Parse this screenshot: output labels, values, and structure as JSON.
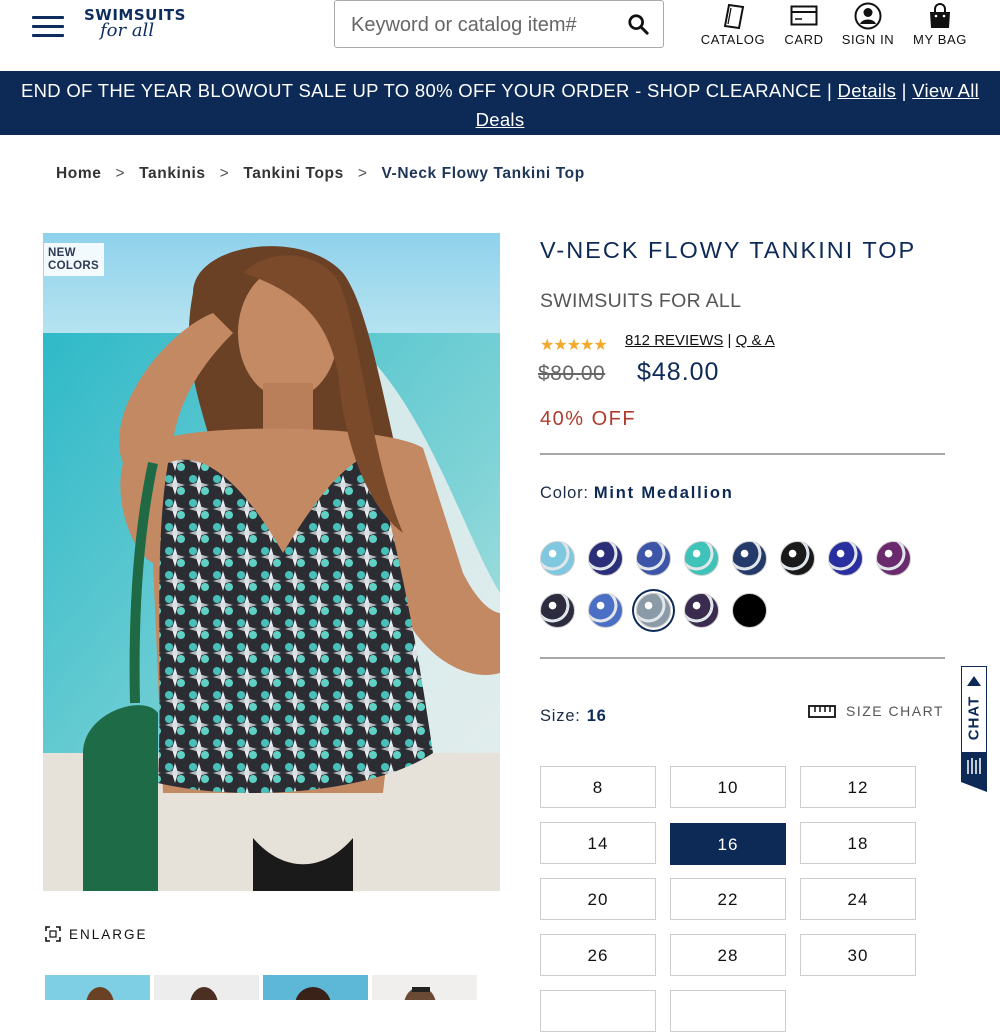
{
  "header": {
    "logo_top": "SWIMSUITS",
    "logo_bottom": "for all",
    "search_placeholder": "Keyword or catalog item#",
    "nav": [
      {
        "label": "CATALOG",
        "icon": "catalog-icon"
      },
      {
        "label": "CARD",
        "icon": "card-icon"
      },
      {
        "label": "SIGN IN",
        "icon": "user-icon"
      },
      {
        "label": "MY BAG",
        "icon": "bag-icon"
      }
    ]
  },
  "banner": {
    "text": "END OF THE YEAR BLOWOUT SALE UP TO 80% OFF YOUR ORDER - SHOP CLEARANCE",
    "sep": "|",
    "details": "Details",
    "view_all": "View All Deals"
  },
  "breadcrumb": [
    "Home",
    "Tankinis",
    "Tankini Tops",
    "V-Neck Flowy Tankini Top"
  ],
  "breadcrumb_sep": ">",
  "gallery": {
    "badge_line1": "NEW",
    "badge_line2": "COLORS",
    "enlarge": "ENLARGE"
  },
  "product": {
    "title": "V-NECK FLOWY TANKINI TOP",
    "brand": "SWIMSUITS FOR ALL",
    "stars": "★★★★★",
    "rating": 4.5,
    "reviews": "812 REVIEWS",
    "qa": "Q & A",
    "review_sep": "|",
    "old_price": "$80.00",
    "price": "$48.00",
    "discount": "40% OFF",
    "color_label": "Color:",
    "color_value": "Mint Medallion",
    "size_label": "Size:",
    "size_value": "16",
    "size_chart": "SIZE CHART",
    "sizes": [
      "8",
      "10",
      "12",
      "14",
      "16",
      "18",
      "20",
      "22",
      "24",
      "26",
      "28",
      "30"
    ],
    "swatch_colors": [
      "#7fc8e0",
      "#2b2f7a",
      "#3d55a8",
      "#3fc3b8",
      "#243a6b",
      "#1a1a1a",
      "#2a2fa0",
      "#6b2a6e",
      "#2c2c3e",
      "#4a6fc4",
      "#8a9aa6",
      "#3a2b4f",
      "#000000"
    ],
    "selected_swatch": 10
  },
  "chat": {
    "label": "CHAT"
  },
  "colors": {
    "navy": "#0d2a56",
    "sale_red": "#b03a2e",
    "star": "#f2a92c"
  }
}
